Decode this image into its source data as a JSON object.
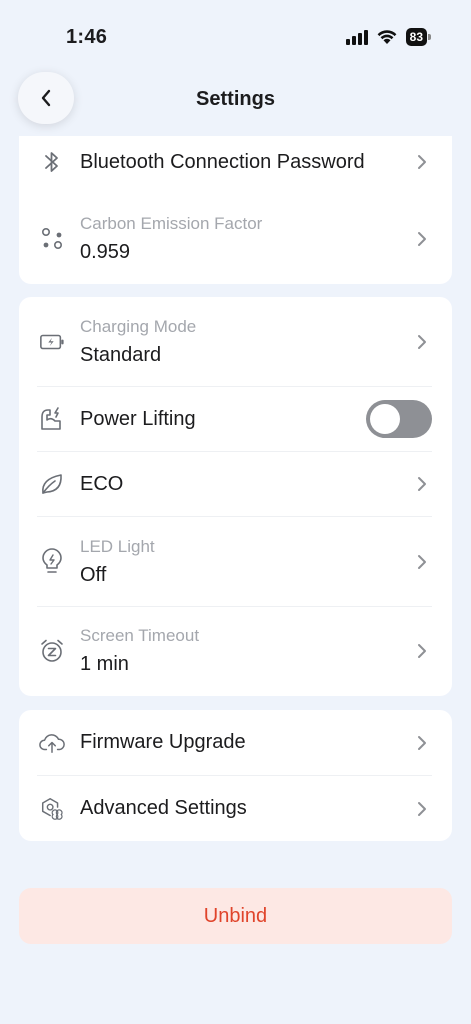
{
  "status_bar": {
    "time": "1:46",
    "battery": "83",
    "icons": [
      "signal-icon",
      "wifi-icon",
      "battery-icon"
    ]
  },
  "nav": {
    "title": "Settings",
    "back_icon": "chevron-left-icon"
  },
  "card1": {
    "bluetooth": {
      "label": "Bluetooth Connection Password",
      "icon": "bluetooth-icon"
    },
    "carbon": {
      "label": "Carbon Emission Factor",
      "value": "0.959",
      "icon": "nodes-icon"
    }
  },
  "card2": {
    "charging_mode": {
      "label": "Charging Mode",
      "value": "Standard",
      "icon": "battery-charging-icon"
    },
    "power_lifting": {
      "label": "Power Lifting",
      "enabled": false,
      "icon": "power-lifting-icon"
    },
    "eco": {
      "label": "ECO",
      "icon": "leaf-icon"
    },
    "led_light": {
      "label": "LED Light",
      "value": "Off",
      "icon": "lightbulb-icon"
    },
    "screen_timeout": {
      "label": "Screen Timeout",
      "value": "1 min",
      "icon": "alarm-clock-icon"
    }
  },
  "card3": {
    "firmware": {
      "label": "Firmware Upgrade",
      "icon": "cloud-upload-icon"
    },
    "advanced": {
      "label": "Advanced Settings",
      "icon": "advanced-settings-icon"
    }
  },
  "unbind": {
    "label": "Unbind"
  },
  "colors": {
    "background": "#eef3fb",
    "card": "#ffffff",
    "text": "#1c1c1e",
    "sublabel": "#a4a7ad",
    "icon": "#6b6f76",
    "toggle_off": "#8e9095",
    "danger_bg": "#fde8e4",
    "danger_text": "#e0442b"
  }
}
